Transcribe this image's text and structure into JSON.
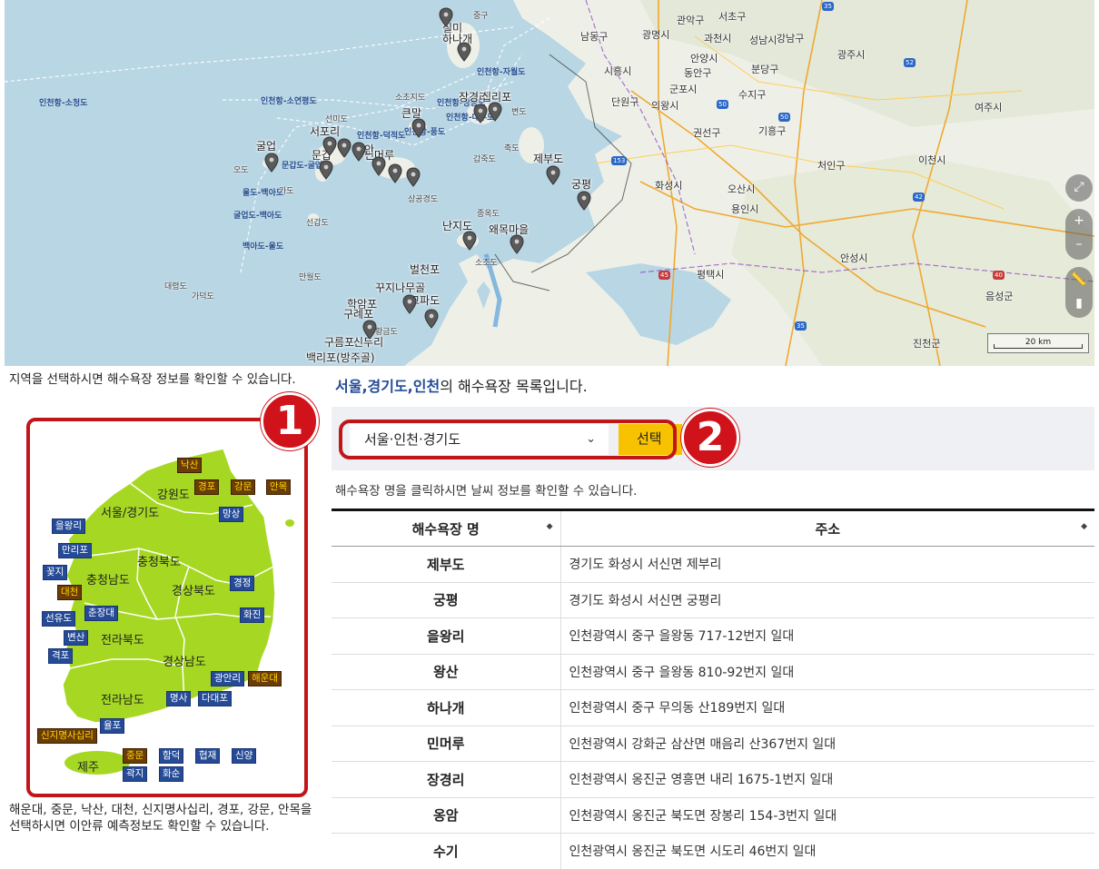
{
  "map": {
    "sea_labels": [
      "인천항-소청도",
      "인천항-소연평도",
      "인천항-덕적도",
      "인천항-자월도",
      "인천항-장봉도",
      "인천항-대부도",
      "문갑도-굴업도",
      "울도-백아도",
      "굴업도-백아도",
      "백아도-울도",
      "인천항-풍도"
    ],
    "island_labels": [
      "중구",
      "소초지도",
      "선미도",
      "오도",
      "가도",
      "선갑도",
      "만월도",
      "대령도",
      "가덕도",
      "갑죽도",
      "상공경도",
      "축도",
      "변도",
      "종옥도",
      "소조도",
      "황금도"
    ],
    "city_labels": [
      "관악구",
      "서초구",
      "남동구",
      "광명시",
      "과천시",
      "성남시",
      "강남구",
      "광주시",
      "시흥시",
      "안양시",
      "분당구",
      "동안구",
      "군포시",
      "단원구",
      "수지구",
      "여주시",
      "기흥구",
      "권선구",
      "의왕시",
      "처인구",
      "이천시",
      "화성시",
      "오산시",
      "안성시",
      "평택시",
      "음성군",
      "진천군",
      "용인시"
    ],
    "beach_labels": [
      "실미",
      "하나개",
      "큰말",
      "장경리",
      "십리포",
      "서포리",
      "굴업",
      "문갑",
      "민머루",
      "벌안",
      "제부도",
      "궁평",
      "난지도",
      "왜목마을",
      "벌천포",
      "꾸지나무골",
      "학암포",
      "구례포",
      "고파도",
      "구름포",
      "신두리",
      "백리포(방주골)"
    ],
    "road_badges": [
      "35",
      "52",
      "50",
      "50",
      "42",
      "35",
      "153",
      "40",
      "45"
    ],
    "scale_label": "20 km"
  },
  "left_panel": {
    "intro": "지역을 선택하시면 해수욕장 정보를 확인할 수 있습니다.",
    "outro": "해운대, 중문, 낙산, 대천, 신지명사십리, 경포, 강문, 안목을 선택하시면 이안류 예측정보도 확인할 수 있습니다.",
    "regions": {
      "gangwon": "강원도",
      "seoul_gyeonggi": "서울/경기도",
      "chungbuk": "충청북도",
      "chungnam": "충청남도",
      "gyeongbuk": "경상북도",
      "jeonbuk": "전라북도",
      "gyeongnam": "경상남도",
      "jeonnam": "전라남도",
      "jeju": "제주"
    },
    "beaches": {
      "naksan": "낙산",
      "gyeongpo": "경포",
      "gangmun": "강문",
      "anmok": "안목",
      "mangsang": "망상",
      "eulwangri": "을왕리",
      "manlipo": "만리포",
      "kkotji": "꽃지",
      "daecheon": "대천",
      "chunjangdae": "춘장대",
      "seonyudo": "선유도",
      "byeonsan": "변산",
      "gyeokpo": "격포",
      "gyeongjeong": "경정",
      "hwajin": "화진",
      "gwangalli": "광안리",
      "haeundae": "해운대",
      "myeongsa": "명사",
      "dadaepo": "다대포",
      "ulpo": "율포",
      "sinji": "신지명사십리",
      "jungmun": "중문",
      "hamdeok": "함덕",
      "hyeopjae": "협재",
      "sinyang": "신양",
      "gwakji": "곽지",
      "hwasun": "화순"
    },
    "badge_1": "1"
  },
  "main": {
    "title_hl": "서울,경기도,인천",
    "title_rest": "의 해수욕장 목록입니다.",
    "select_value": "서울·인천·경기도",
    "select_button": "선택",
    "badge_2": "2",
    "hint": "해수욕장 명을 클릭하시면 날씨 정보를 확인할 수 있습니다.",
    "table": {
      "headers": [
        "해수욕장 명",
        "주소"
      ],
      "rows": [
        {
          "name": "제부도",
          "address": "경기도 화성시 서신면 제부리"
        },
        {
          "name": "궁평",
          "address": "경기도 화성시 서신면 궁평리"
        },
        {
          "name": "을왕리",
          "address": "인천광역시 중구 을왕동 717-12번지 일대"
        },
        {
          "name": "왕산",
          "address": "인천광역시 중구 을왕동 810-92번지 일대"
        },
        {
          "name": "하나개",
          "address": "인천광역시 중구 무의동 산189번지 일대"
        },
        {
          "name": "민머루",
          "address": "인천광역시 강화군 삼산면 매음리 산367번지 일대"
        },
        {
          "name": "장경리",
          "address": "인천광역시 옹진군 영흥면 내리 1675-1번지 일대"
        },
        {
          "name": "옹암",
          "address": "인천광역시 옹진군 북도면 장봉리 154-3번지 일대"
        },
        {
          "name": "수기",
          "address": "인천광역시 옹진군 북도면 시도리 46번지 일대"
        }
      ]
    }
  },
  "colors": {
    "accent_red": "#c0161a",
    "beach_blue": "#254b97",
    "beach_gold": "#6b3c08",
    "button_yellow": "#f7c200",
    "land_green": "#a6d823"
  }
}
